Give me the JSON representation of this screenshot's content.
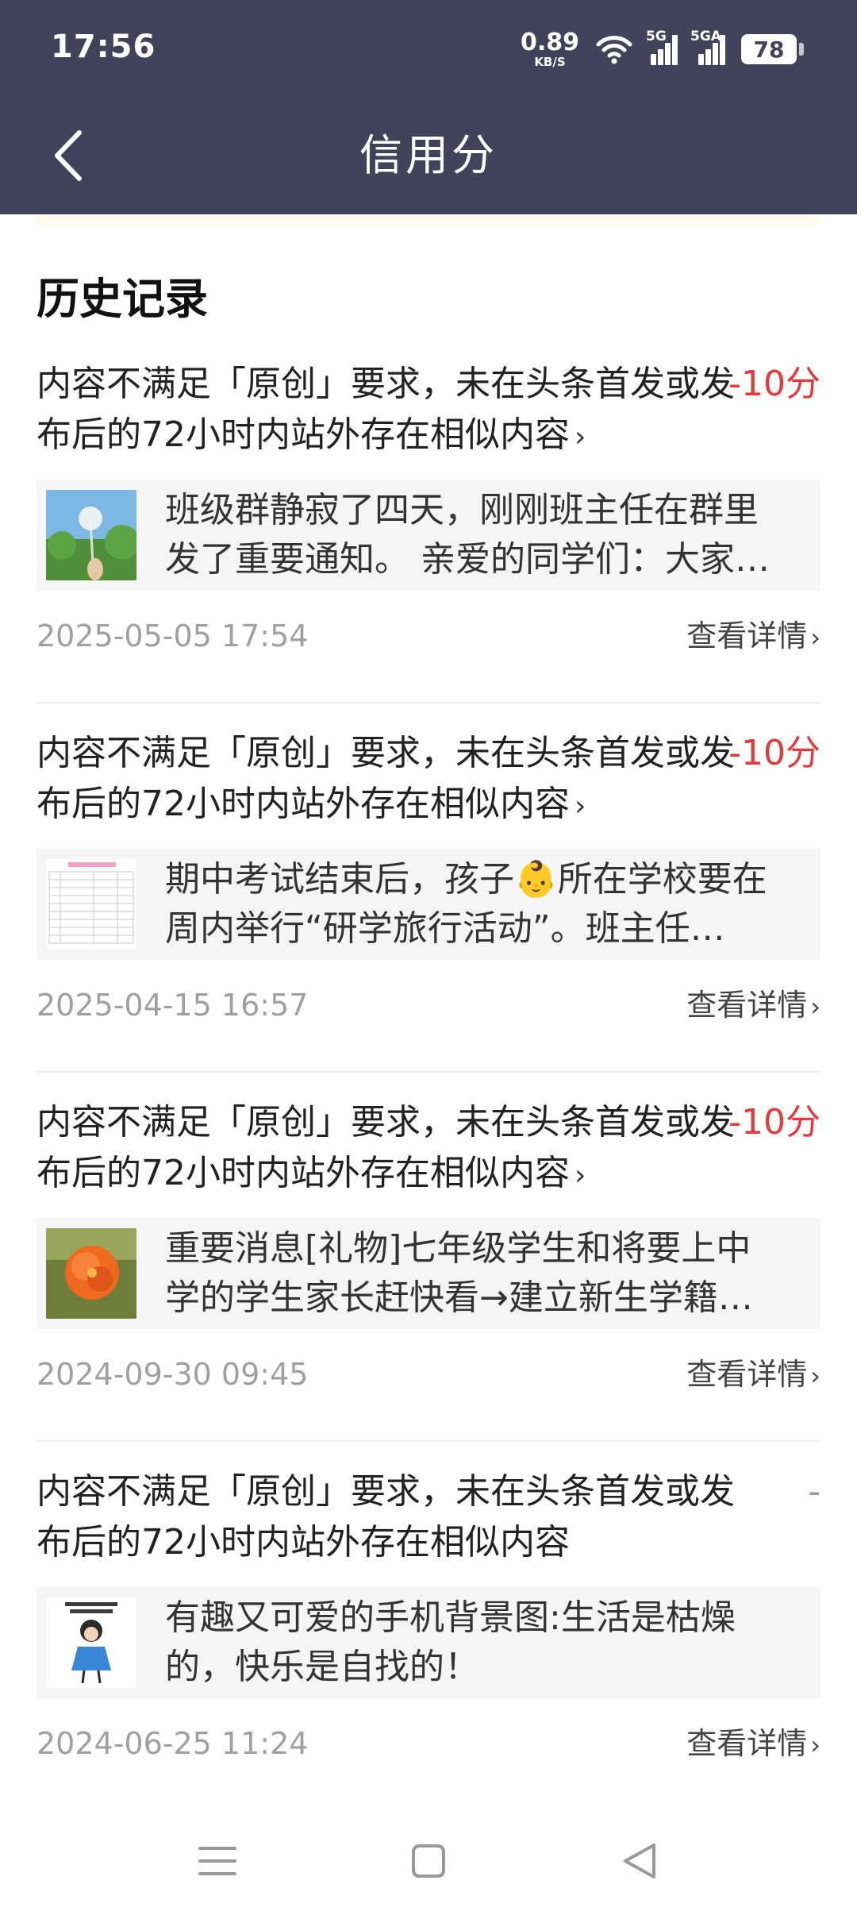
{
  "status_bar": {
    "time": "17:56",
    "net_speed_value": "0.89",
    "net_speed_unit": "KB/S",
    "signal1_label": "5G",
    "signal2_label": "5GA",
    "battery": "78",
    "icons": [
      "wifi-icon",
      "signal-5g-icon",
      "signal-5ga-icon",
      "battery-icon"
    ]
  },
  "header": {
    "title": "信用分",
    "back_icon": "chevron-left-icon"
  },
  "section": {
    "title": "历史记录"
  },
  "records": [
    {
      "reason": "内容不满足「原创」要求，未在头条首发或发布后的72小时内站外存在相似内容",
      "show_arrow": true,
      "score": "-10分",
      "article": "班级群静寂了四天，刚刚班主任在群里发了重要通知。 亲爱的同学们：大家…",
      "thumb": "dandelion-photo",
      "date": "2025-05-05 17:54",
      "detail": "查看详情"
    },
    {
      "reason": "内容不满足「原创」要求，未在头条首发或发布后的72小时内站外存在相似内容",
      "show_arrow": true,
      "score": "-10分",
      "article": "期中考试结束后，孩子👶所在学校要在周内举行“研学旅行活动”。班主任…",
      "thumb": "table-document",
      "date": "2025-04-15 16:57",
      "detail": "查看详情"
    },
    {
      "reason": "内容不满足「原创」要求，未在头条首发或发布后的72小时内站外存在相似内容",
      "show_arrow": true,
      "score": "-10分",
      "article": "重要消息[礼物]七年级学生和将要上中学的学生家长赶快看→建立新生学籍…",
      "thumb": "orange-flower-photo",
      "date": "2024-09-30 09:45",
      "detail": "查看详情"
    },
    {
      "reason": "内容不满足「原创」要求，未在头条首发或发布后的72小时内站外存在相似内容",
      "show_arrow": false,
      "score": "-",
      "article": "有趣又可爱的手机背景图:生活是枯燥的，快乐是自找的！",
      "thumb": "cartoon-girl-wallpaper",
      "date": "2024-06-25 11:24",
      "detail": "查看详情"
    }
  ],
  "colors": {
    "header_bg": "#42435a",
    "score_red": "#e33b3b",
    "card_bg": "#f5f5f5"
  },
  "nav": {
    "icons": [
      "menu-icon",
      "home-square-icon",
      "back-triangle-icon"
    ]
  }
}
